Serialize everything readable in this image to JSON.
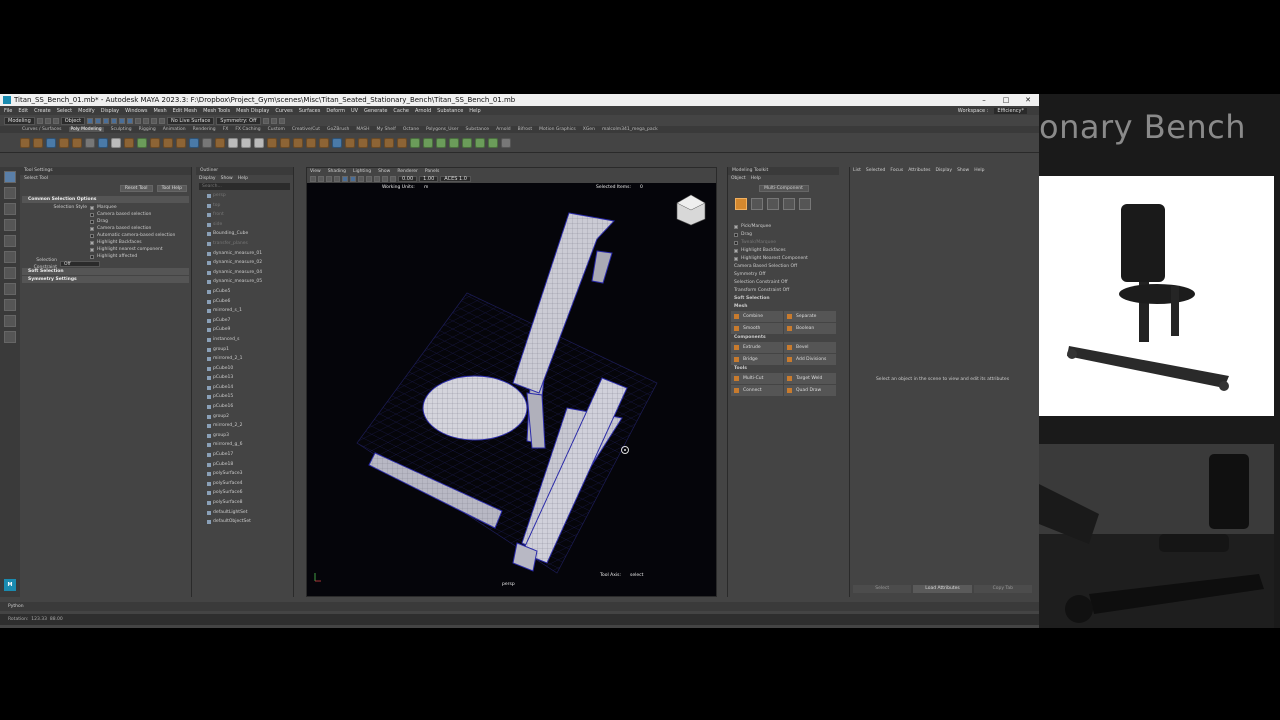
{
  "window": {
    "title": "Titan_SS_Bench_01.mb* - Autodesk MAYA 2023.3: F:\\Dropbox\\Project_Gym\\scenes\\Misc\\Titan_Seated_Stationary_Bench\\Titan_SS_Bench_01.mb",
    "min": "–",
    "max": "□",
    "close": "✕"
  },
  "menus": [
    "File",
    "Edit",
    "Create",
    "Select",
    "Modify",
    "Display",
    "Windows",
    "Mesh",
    "Edit Mesh",
    "Mesh Tools",
    "Mesh Display",
    "Curves",
    "Surfaces",
    "Deform",
    "UV",
    "Generate",
    "Cache",
    "Arnold",
    "Substance",
    "Help"
  ],
  "workspace": {
    "label": "Workspace :",
    "value": "Efficiency*"
  },
  "status": {
    "menuset": "Modeling",
    "mode": "Object",
    "live": "No Live Surface",
    "symmetry": "Symmetry: Off"
  },
  "shelf_tabs": [
    "Curves / Surfaces",
    "Poly Modeling",
    "Sculpting",
    "Rigging",
    "Animation",
    "Rendering",
    "FX",
    "FX Caching",
    "Custom",
    "Creative/Cut",
    "GoZBrush",
    "MASH",
    "My Shelf",
    "Octane",
    "Polygons_User",
    "Substance",
    "Arnold",
    "Bifrost",
    "Motion Graphics",
    "XGen",
    "malcolm341_mega_pack"
  ],
  "shelf_active": "Poly Modeling",
  "tool_settings": {
    "header": "Tool Settings",
    "tool": "Select Tool",
    "reset": "Reset Tool",
    "help": "Tool Help",
    "common": "Common Selection Options",
    "style_label": "Selection Style",
    "style_value": "Marquee",
    "camera": "Camera based selection",
    "drag": "Drag",
    "camera2": "Camera based selection",
    "auto": "Automatic camera-based selection",
    "backfaces": "Highlight Backfaces",
    "nearest": "Highlight nearest component",
    "affected": "Highlight affected",
    "constraint_label": "Selection Constraint",
    "constraint_value": "Off",
    "soft": "Soft Selection",
    "sym": "Symmetry Settings"
  },
  "outliner": {
    "title": "Outliner",
    "menu": [
      "Display",
      "Show",
      "Help"
    ],
    "search": "Search...",
    "items": [
      "persp",
      "top",
      "front",
      "side",
      "Bounding_Cube",
      "transfer_planes",
      "dynamic_measure_01",
      "dynamic_measure_02",
      "dynamic_measure_04",
      "dynamic_measure_05",
      "pCube5",
      "pCube6",
      "mirrored_s_1",
      "pCube7",
      "pCube9",
      "instanced_s",
      "group1",
      "mirrored_2_1",
      "pCube10",
      "pCube13",
      "pCube14",
      "pCube15",
      "pCube16",
      "group2",
      "mirrored_2_2",
      "group3",
      "mirrored_g_6",
      "pCube17",
      "pCube18",
      "polySurface3",
      "polySurface4",
      "polySurface6",
      "polySurface8",
      "defaultLightSet",
      "defaultObjectSet"
    ]
  },
  "viewport": {
    "menu": [
      "View",
      "Shading",
      "Lighting",
      "Show",
      "Renderer",
      "Panels"
    ],
    "working_units": "Working Units:",
    "units_value": "m",
    "selected_label": "Selected Items:",
    "selected_value": "0",
    "cam": "persp",
    "tool_axis_label": "Tool Axis:",
    "tool_axis_value": "select",
    "field1": "0.00",
    "field2": "1.00",
    "aces": "ACES 1.0"
  },
  "modeling_toolkit": {
    "title": "Modeling Toolkit",
    "menu": [
      "Object",
      "Help"
    ],
    "multi": "Multi-Component",
    "pick": "Pick/Marquee",
    "drag": "Drag",
    "tweak": "Tweak/Marquee",
    "backfaces": "Highlight Backfaces",
    "nearest": "Highlight Nearest Component",
    "camera": "Camera Based Selection",
    "camera_val": "Off",
    "symmetry": "Symmetry",
    "symmetry_val": "Off",
    "sel_constraint": "Selection Constraint",
    "sel_val": "Off",
    "transform": "Transform Constraint",
    "transform_val": "Off",
    "soft": "Soft Selection",
    "mesh": "Mesh",
    "combine": "Combine",
    "separate": "Separate",
    "smooth": "Smooth",
    "boolean": "Boolean",
    "components": "Components",
    "extrude": "Extrude",
    "bevel": "Bevel",
    "bridge": "Bridge",
    "add_div": "Add Divisions",
    "tools": "Tools",
    "multicut": "Multi-Cut",
    "target": "Target Weld",
    "connect": "Connect",
    "quad": "Quad Draw"
  },
  "attribute_editor": {
    "menu": [
      "List",
      "Selected",
      "Focus",
      "Attributes",
      "Display",
      "Show",
      "Help"
    ],
    "msg": "Select an object in the scene to view and edit its attributes",
    "select": "Select",
    "load": "Load Attributes",
    "copy": "Copy Tab"
  },
  "cmd": {
    "python": "Python"
  },
  "help_line": {
    "rotation": "Rotation:",
    "v1": "123.33",
    "v2": "88.00"
  },
  "reference": {
    "title": "onary Bench"
  }
}
